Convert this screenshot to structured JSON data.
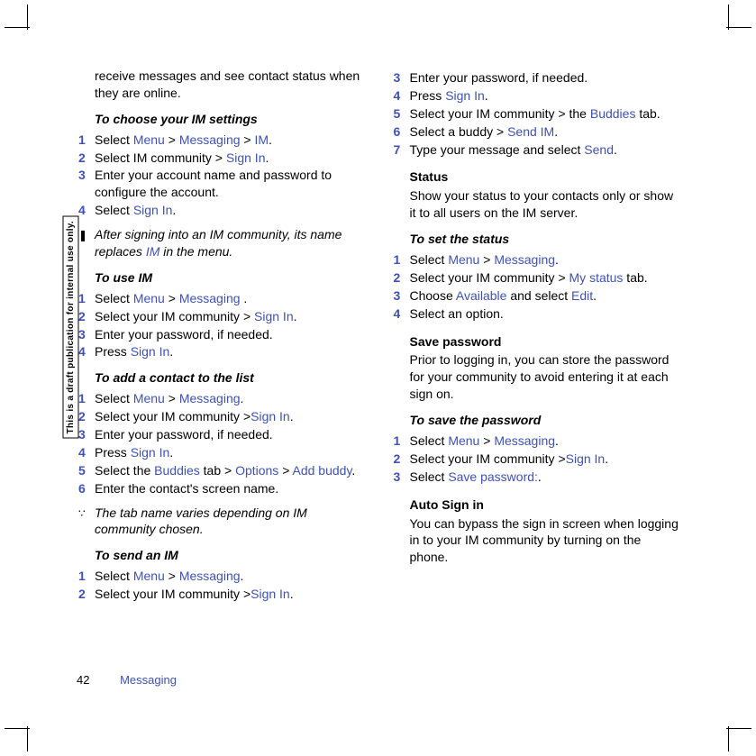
{
  "sidebar_label": "This is a draft publication for internal use only.",
  "col1": {
    "intro_continued": "receive messages and see contact status when they are online.",
    "sec1_heading": "To choose your IM settings",
    "sec1_steps": [
      {
        "n": "1",
        "pre": "Select ",
        "l1": "Menu",
        "m1": " > ",
        "l2": "Messaging",
        "m2": " > ",
        "l3": "IM",
        "post": "."
      },
      {
        "n": "2",
        "pre": "Select IM community > ",
        "l1": "Sign In",
        "post": "."
      },
      {
        "n": "3",
        "text": "Enter your account name and password to configure the account."
      },
      {
        "n": "4",
        "pre": "Select ",
        "l1": "Sign In",
        "post": "."
      }
    ],
    "note1": {
      "pre": "After signing into an IM community, its name replaces ",
      "l1": "IM",
      "post": " in the menu."
    },
    "sec2_heading": "To use IM",
    "sec2_steps": [
      {
        "n": "1",
        "pre": "Select ",
        "l1": "Menu",
        "m1": " > ",
        "l2": "Messaging",
        "post": " ."
      },
      {
        "n": "2",
        "pre": "Select your IM community > ",
        "l1": "Sign In",
        "post": "."
      },
      {
        "n": "3",
        "text": "Enter your password, if needed."
      },
      {
        "n": "4",
        "pre": "Press ",
        "l1": "Sign In",
        "post": "."
      }
    ],
    "sec3_heading": "To add a contact to the list",
    "sec3_steps": [
      {
        "n": "1",
        "pre": "Select ",
        "l1": "Menu",
        "m1": " > ",
        "l2": "Messaging",
        "post": "."
      },
      {
        "n": "2",
        "pre": "Select your IM community >",
        "l1": "Sign In",
        "post": "."
      },
      {
        "n": "3",
        "text": "Enter your password, if needed."
      },
      {
        "n": "4",
        "pre": "Press ",
        "l1": "Sign In",
        "post": "."
      },
      {
        "n": "5",
        "pre": "Select the ",
        "l1": "Buddies",
        "m1": " tab > ",
        "l2": "Options",
        "m2": " > ",
        "l3": "Add buddy",
        "post": "."
      },
      {
        "n": "6",
        "text": "Enter the contact's screen name."
      }
    ],
    "note2": "The tab name varies depending on IM community chosen.",
    "sec4_heading": "To send an IM",
    "sec4_steps": [
      {
        "n": "1",
        "pre": "Select ",
        "l1": "Menu",
        "m1": " > ",
        "l2": "Messaging",
        "post": "."
      },
      {
        "n": "2",
        "pre": "Select your IM community >",
        "l1": "Sign In",
        "post": "."
      }
    ]
  },
  "col2": {
    "sec4_cont_steps": [
      {
        "n": "3",
        "text": "Enter your password, if needed."
      },
      {
        "n": "4",
        "pre": "Press ",
        "l1": "Sign In",
        "post": "."
      },
      {
        "n": "5",
        "pre": "Select your IM community > the ",
        "l1": "Buddies",
        "post": " tab."
      },
      {
        "n": "6",
        "pre": "Select a buddy > ",
        "l1": "Send IM",
        "post": "."
      },
      {
        "n": "7",
        "pre": "Type your message and select ",
        "l1": "Send",
        "post": "."
      }
    ],
    "sec5_heading": "Status",
    "sec5_para": "Show your status to your contacts only or show it to all users on the IM server.",
    "sec6_heading": "To set the status",
    "sec6_steps": [
      {
        "n": "1",
        "pre": "Select ",
        "l1": "Menu",
        "m1": " > ",
        "l2": "Messaging",
        "post": "."
      },
      {
        "n": "2",
        "pre": "Select your IM community > ",
        "l1": "My status",
        "post": " tab."
      },
      {
        "n": "3",
        "pre": "Choose ",
        "l1": "Available",
        "m1": " and select ",
        "l2": "Edit",
        "post": "."
      },
      {
        "n": "4",
        "text": "Select an option."
      }
    ],
    "sec7_heading": "Save password",
    "sec7_para": "Prior to logging in, you can store the password for your community to avoid entering it at each sign on.",
    "sec8_heading": "To save the password",
    "sec8_steps": [
      {
        "n": "1",
        "pre": "Select ",
        "l1": "Menu",
        "m1": " > ",
        "l2": "Messaging",
        "post": "."
      },
      {
        "n": "2",
        "pre": "Select your IM community >",
        "l1": "Sign In",
        "post": "."
      },
      {
        "n": "3",
        "pre": "Select ",
        "l1": "Save password:",
        "post": "."
      }
    ],
    "sec9_heading": "Auto Sign in",
    "sec9_para": "You can bypass the sign in screen when logging in to your IM community by turning on the phone."
  },
  "footer": {
    "page_number": "42",
    "section_title": "Messaging"
  }
}
